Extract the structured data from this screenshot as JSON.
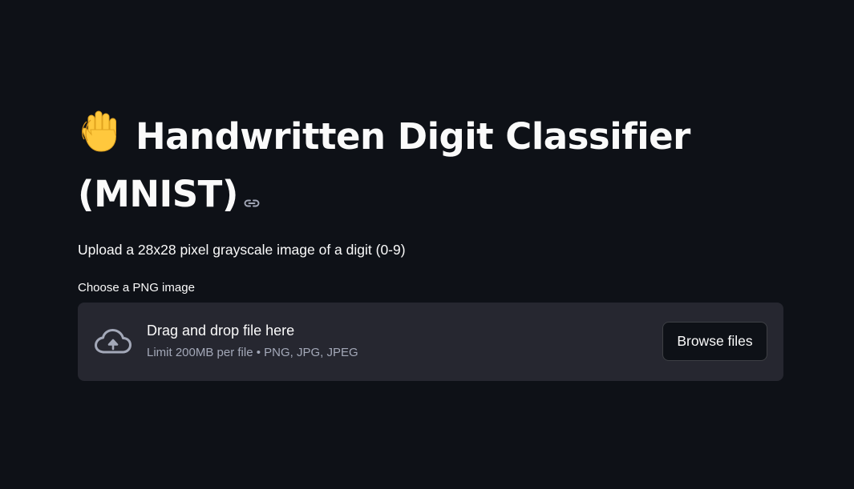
{
  "page": {
    "title": "Handwritten Digit Classifier (MNIST)",
    "title_icon": "raised-hand-emoji",
    "anchor_icon": "link-icon",
    "subtitle": "Upload a 28x28 pixel grayscale image of a digit (0-9)"
  },
  "uploader": {
    "label": "Choose a PNG image",
    "icon": "cloud-upload-icon",
    "drop_text": "Drag and drop file here",
    "limit_text": "Limit 200MB per file • PNG, JPG, JPEG",
    "browse_label": "Browse files"
  },
  "colors": {
    "background": "#0e1117",
    "dropzone": "#262730",
    "text": "#fafafa",
    "muted_text": "#a3a8b8"
  }
}
